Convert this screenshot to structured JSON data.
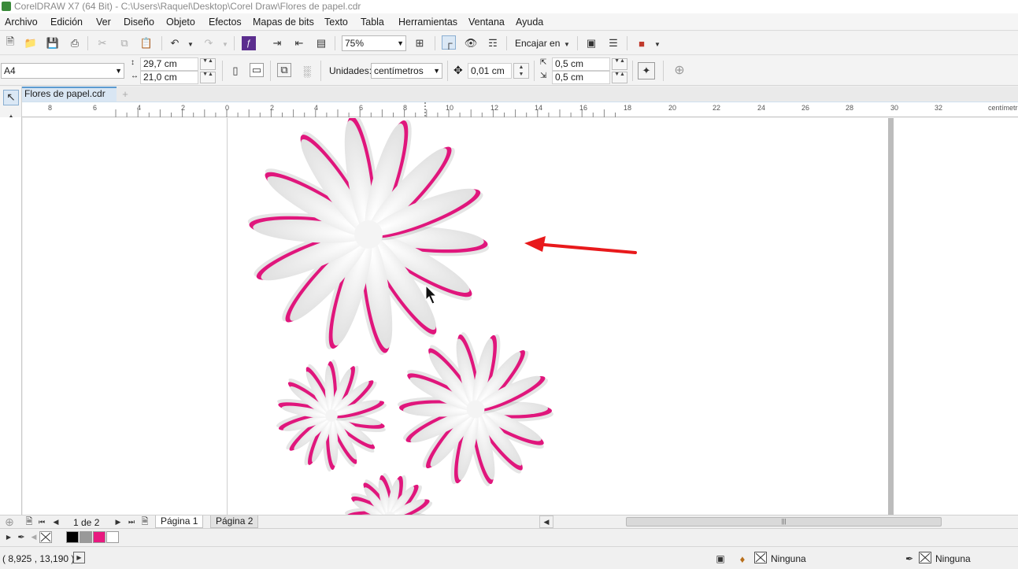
{
  "window": {
    "title": "CorelDRAW X7 (64 Bit) - C:\\Users\\Raquel\\Desktop\\Corel Draw\\Flores de papel.cdr"
  },
  "menu": [
    "Archivo",
    "Edición",
    "Ver",
    "Diseño",
    "Objeto",
    "Efectos",
    "Mapas de bits",
    "Texto",
    "Tabla",
    "Herramientas",
    "Ventana",
    "Ayuda"
  ],
  "toolbar": {
    "zoom": "75%",
    "snap_label": "Encajar en"
  },
  "properties": {
    "page_size": "A4",
    "width": "29,7 cm",
    "height": "21,0 cm",
    "units_label": "Unidades:",
    "units_value": "centímetros",
    "nudge": "0,01 cm",
    "dup_x": "0,5 cm",
    "dup_y": "0,5 cm"
  },
  "document_tab": "Flores de papel.cdr",
  "ruler": {
    "unit": "centímetros",
    "labels": [
      "8",
      "6",
      "4",
      "2",
      "0",
      "2",
      "4",
      "6",
      "8",
      "10",
      "12",
      "14",
      "16",
      "18",
      "20",
      "22",
      "24",
      "26",
      "28",
      "30",
      "32"
    ]
  },
  "page_nav": {
    "counter": "1 de 2",
    "pages": [
      "Página 1",
      "Página 2"
    ]
  },
  "palette": {
    "colors": [
      "#000000",
      "#999999",
      "#e8197f",
      "#ffffff"
    ]
  },
  "status": {
    "coords": "( 8,925 , 13,190 )",
    "fill": "Ninguna",
    "outline": "Ninguna"
  },
  "colors": {
    "petal_accent": "#e0167c",
    "arrow": "#e8191b"
  }
}
